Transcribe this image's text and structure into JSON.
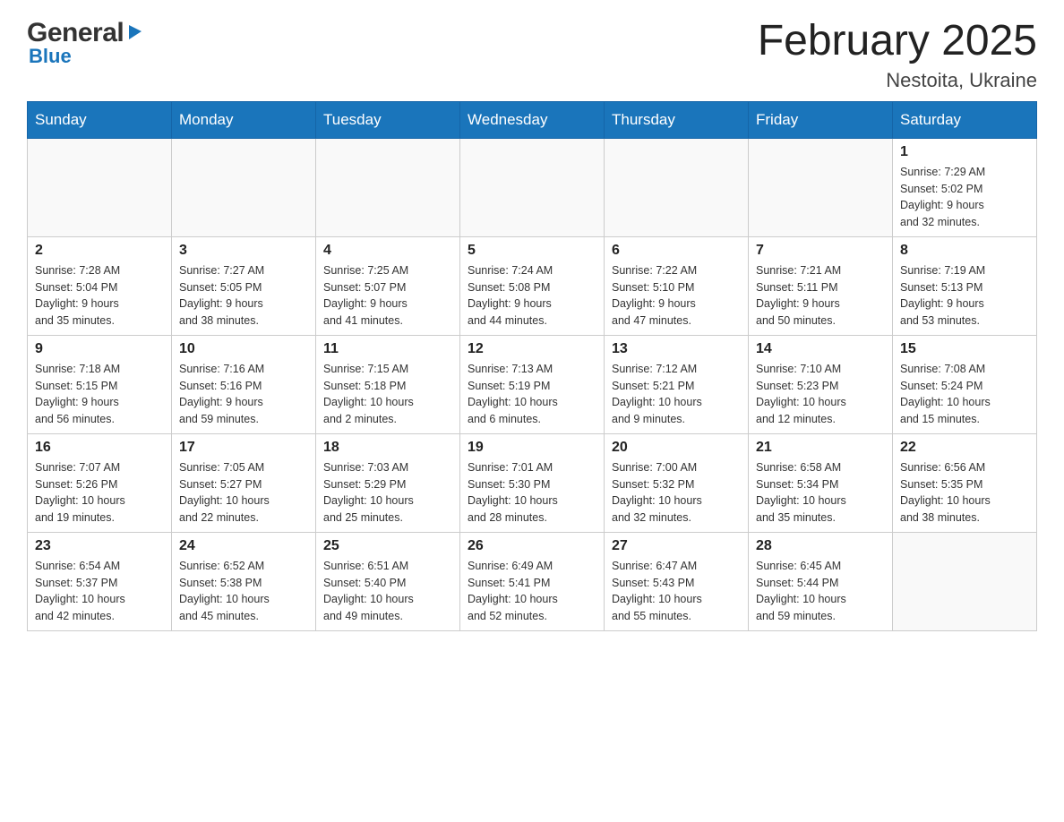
{
  "logo": {
    "part1": "General",
    "arrow": "▶",
    "part2": "Blue"
  },
  "title": "February 2025",
  "subtitle": "Nestoita, Ukraine",
  "weekdays": [
    "Sunday",
    "Monday",
    "Tuesday",
    "Wednesday",
    "Thursday",
    "Friday",
    "Saturday"
  ],
  "weeks": [
    [
      {
        "day": "",
        "info": ""
      },
      {
        "day": "",
        "info": ""
      },
      {
        "day": "",
        "info": ""
      },
      {
        "day": "",
        "info": ""
      },
      {
        "day": "",
        "info": ""
      },
      {
        "day": "",
        "info": ""
      },
      {
        "day": "1",
        "info": "Sunrise: 7:29 AM\nSunset: 5:02 PM\nDaylight: 9 hours\nand 32 minutes."
      }
    ],
    [
      {
        "day": "2",
        "info": "Sunrise: 7:28 AM\nSunset: 5:04 PM\nDaylight: 9 hours\nand 35 minutes."
      },
      {
        "day": "3",
        "info": "Sunrise: 7:27 AM\nSunset: 5:05 PM\nDaylight: 9 hours\nand 38 minutes."
      },
      {
        "day": "4",
        "info": "Sunrise: 7:25 AM\nSunset: 5:07 PM\nDaylight: 9 hours\nand 41 minutes."
      },
      {
        "day": "5",
        "info": "Sunrise: 7:24 AM\nSunset: 5:08 PM\nDaylight: 9 hours\nand 44 minutes."
      },
      {
        "day": "6",
        "info": "Sunrise: 7:22 AM\nSunset: 5:10 PM\nDaylight: 9 hours\nand 47 minutes."
      },
      {
        "day": "7",
        "info": "Sunrise: 7:21 AM\nSunset: 5:11 PM\nDaylight: 9 hours\nand 50 minutes."
      },
      {
        "day": "8",
        "info": "Sunrise: 7:19 AM\nSunset: 5:13 PM\nDaylight: 9 hours\nand 53 minutes."
      }
    ],
    [
      {
        "day": "9",
        "info": "Sunrise: 7:18 AM\nSunset: 5:15 PM\nDaylight: 9 hours\nand 56 minutes."
      },
      {
        "day": "10",
        "info": "Sunrise: 7:16 AM\nSunset: 5:16 PM\nDaylight: 9 hours\nand 59 minutes."
      },
      {
        "day": "11",
        "info": "Sunrise: 7:15 AM\nSunset: 5:18 PM\nDaylight: 10 hours\nand 2 minutes."
      },
      {
        "day": "12",
        "info": "Sunrise: 7:13 AM\nSunset: 5:19 PM\nDaylight: 10 hours\nand 6 minutes."
      },
      {
        "day": "13",
        "info": "Sunrise: 7:12 AM\nSunset: 5:21 PM\nDaylight: 10 hours\nand 9 minutes."
      },
      {
        "day": "14",
        "info": "Sunrise: 7:10 AM\nSunset: 5:23 PM\nDaylight: 10 hours\nand 12 minutes."
      },
      {
        "day": "15",
        "info": "Sunrise: 7:08 AM\nSunset: 5:24 PM\nDaylight: 10 hours\nand 15 minutes."
      }
    ],
    [
      {
        "day": "16",
        "info": "Sunrise: 7:07 AM\nSunset: 5:26 PM\nDaylight: 10 hours\nand 19 minutes."
      },
      {
        "day": "17",
        "info": "Sunrise: 7:05 AM\nSunset: 5:27 PM\nDaylight: 10 hours\nand 22 minutes."
      },
      {
        "day": "18",
        "info": "Sunrise: 7:03 AM\nSunset: 5:29 PM\nDaylight: 10 hours\nand 25 minutes."
      },
      {
        "day": "19",
        "info": "Sunrise: 7:01 AM\nSunset: 5:30 PM\nDaylight: 10 hours\nand 28 minutes."
      },
      {
        "day": "20",
        "info": "Sunrise: 7:00 AM\nSunset: 5:32 PM\nDaylight: 10 hours\nand 32 minutes."
      },
      {
        "day": "21",
        "info": "Sunrise: 6:58 AM\nSunset: 5:34 PM\nDaylight: 10 hours\nand 35 minutes."
      },
      {
        "day": "22",
        "info": "Sunrise: 6:56 AM\nSunset: 5:35 PM\nDaylight: 10 hours\nand 38 minutes."
      }
    ],
    [
      {
        "day": "23",
        "info": "Sunrise: 6:54 AM\nSunset: 5:37 PM\nDaylight: 10 hours\nand 42 minutes."
      },
      {
        "day": "24",
        "info": "Sunrise: 6:52 AM\nSunset: 5:38 PM\nDaylight: 10 hours\nand 45 minutes."
      },
      {
        "day": "25",
        "info": "Sunrise: 6:51 AM\nSunset: 5:40 PM\nDaylight: 10 hours\nand 49 minutes."
      },
      {
        "day": "26",
        "info": "Sunrise: 6:49 AM\nSunset: 5:41 PM\nDaylight: 10 hours\nand 52 minutes."
      },
      {
        "day": "27",
        "info": "Sunrise: 6:47 AM\nSunset: 5:43 PM\nDaylight: 10 hours\nand 55 minutes."
      },
      {
        "day": "28",
        "info": "Sunrise: 6:45 AM\nSunset: 5:44 PM\nDaylight: 10 hours\nand 59 minutes."
      },
      {
        "day": "",
        "info": ""
      }
    ]
  ]
}
